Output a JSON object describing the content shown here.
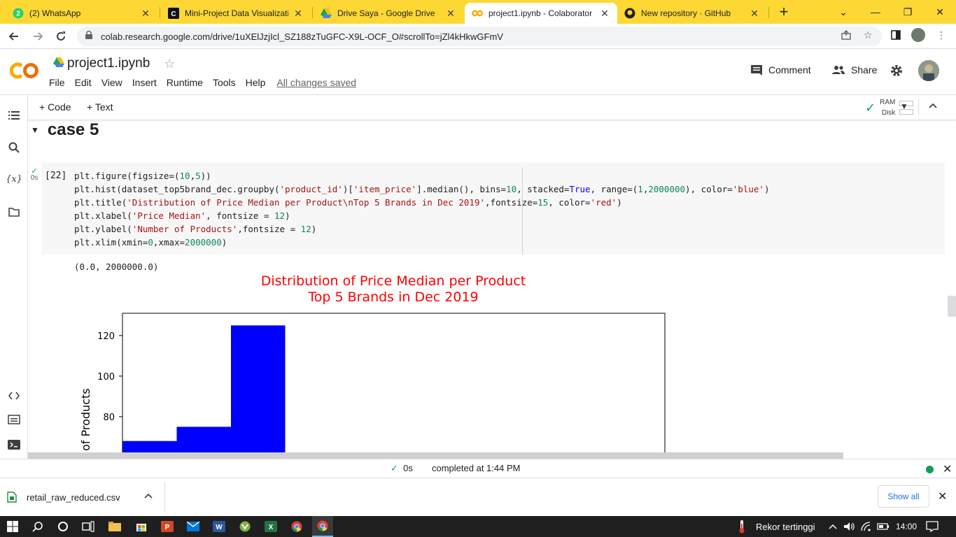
{
  "browser": {
    "tabs": [
      {
        "title": "(2) WhatsApp",
        "badge": "2",
        "icon": "whatsapp-icon",
        "active": false
      },
      {
        "title": "Mini-Project Data Visualizatio",
        "icon": "codecademy-icon",
        "active": false
      },
      {
        "title": "Drive Saya - Google Drive",
        "icon": "google-drive-icon",
        "active": false
      },
      {
        "title": "project1.ipynb - Colaborator",
        "icon": "colab-icon",
        "active": true
      },
      {
        "title": "New repository · GitHub",
        "icon": "github-icon",
        "active": false
      }
    ],
    "url": "colab.research.google.com/drive/1uXElJzjIcl_SZ188zTuGFC-X9L-OCF_O#scrollTo=jZl4kHkwGFmV"
  },
  "colab": {
    "logo_text": "CO",
    "notebook_name": "project1.ipynb",
    "menu": [
      "File",
      "Edit",
      "View",
      "Insert",
      "Runtime",
      "Tools",
      "Help"
    ],
    "saved_status": "All changes saved",
    "comment_label": "Comment",
    "share_label": "Share",
    "add_code": "+ Code",
    "add_text": "+ Text",
    "ram_label": "RAM",
    "disk_label": "Disk"
  },
  "section": {
    "title": "case 5"
  },
  "cell": {
    "exec_count": "[22]",
    "exec_time": "0s",
    "output_text": "(0.0, 2000000.0)"
  },
  "chart_data": {
    "type": "bar",
    "title": "Distribution of Price Median per Product\nTop 5 Brands in Dec 2019",
    "title_lines": [
      "Distribution of Price Median per Product",
      "Top 5 Brands in Dec 2019"
    ],
    "title_color": "#ff0000",
    "bar_color": "#0000ff",
    "ylabel": "of Products",
    "xlim": [
      0,
      2000000
    ],
    "y_ticks": [
      80,
      100,
      120
    ],
    "visible_y_range": [
      63.5,
      131
    ],
    "bins": [
      {
        "x0": 0,
        "x1": 200000,
        "value": 68
      },
      {
        "x0": 200000,
        "x1": 400000,
        "value": 75
      },
      {
        "x0": 400000,
        "x1": 600000,
        "value": 125
      }
    ]
  },
  "status": {
    "time": "0s",
    "completed": "completed at 1:44 PM"
  },
  "downloads": {
    "file_name": "retail_raw_reduced.csv",
    "show_all": "Show all"
  },
  "taskbar": {
    "weather_text": "Rekor tertinggi",
    "clock": "14:00"
  }
}
